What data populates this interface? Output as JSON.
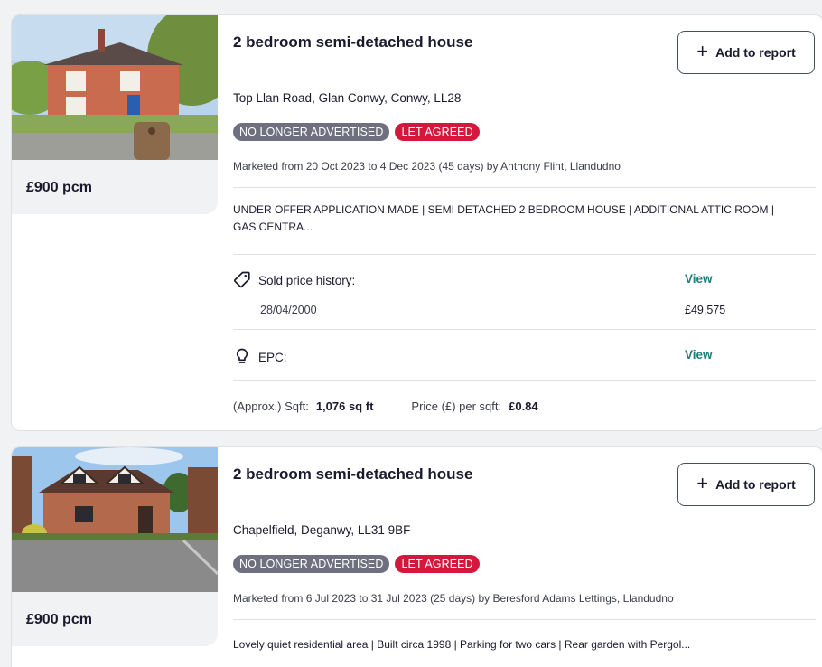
{
  "listings": [
    {
      "price": "£900 pcm",
      "title": "2 bedroom semi-detached house",
      "add_button": "Add to report",
      "address": "Top Llan Road, Glan Conwy, Conwy, LL28",
      "badges": [
        "NO LONGER ADVERTISED",
        "LET AGREED"
      ],
      "marketed": "Marketed from 20 Oct 2023 to 4 Dec 2023 (45 days) by Anthony Flint, Llandudno",
      "description_line1": "UNDER OFFER APPLICATION MADE | SEMI DETACHED 2 BEDROOM HOUSE | ADDITIONAL ATTIC ROOM |",
      "description_line2": "GAS CENTRA...",
      "sold_price_label": "Sold price history:",
      "sold_view": "View",
      "sold_date": "28/04/2000",
      "sold_price": "£49,575",
      "epc_label": "EPC:",
      "epc_view": "View",
      "sqft_label": "(Approx.) Sqft:",
      "sqft_value": "1,076 sq ft",
      "ppsf_label": "Price (£) per sqft:",
      "ppsf_value": "£0.84"
    },
    {
      "price": "£900 pcm",
      "title": "2 bedroom semi-detached house",
      "add_button": "Add to report",
      "address": "Chapelfield, Deganwy, LL31 9BF",
      "badges": [
        "NO LONGER ADVERTISED",
        "LET AGREED"
      ],
      "marketed": "Marketed from 6 Jul 2023 to 31 Jul 2023 (25 days) by Beresford Adams Lettings, Llandudno",
      "description_line1": "Lovely quiet residential area | Built circa 1998 | Parking for two cars | Rear garden with Pergol..."
    }
  ],
  "colors": {
    "badge_grey": "#6e7080",
    "badge_red": "#d3183c",
    "link_teal": "#1e7f7a",
    "price_box_bg": "#f1f2f4"
  },
  "icons": {
    "add": "plus-icon",
    "sold_price": "price-tag-icon",
    "epc": "lightbulb-icon"
  }
}
